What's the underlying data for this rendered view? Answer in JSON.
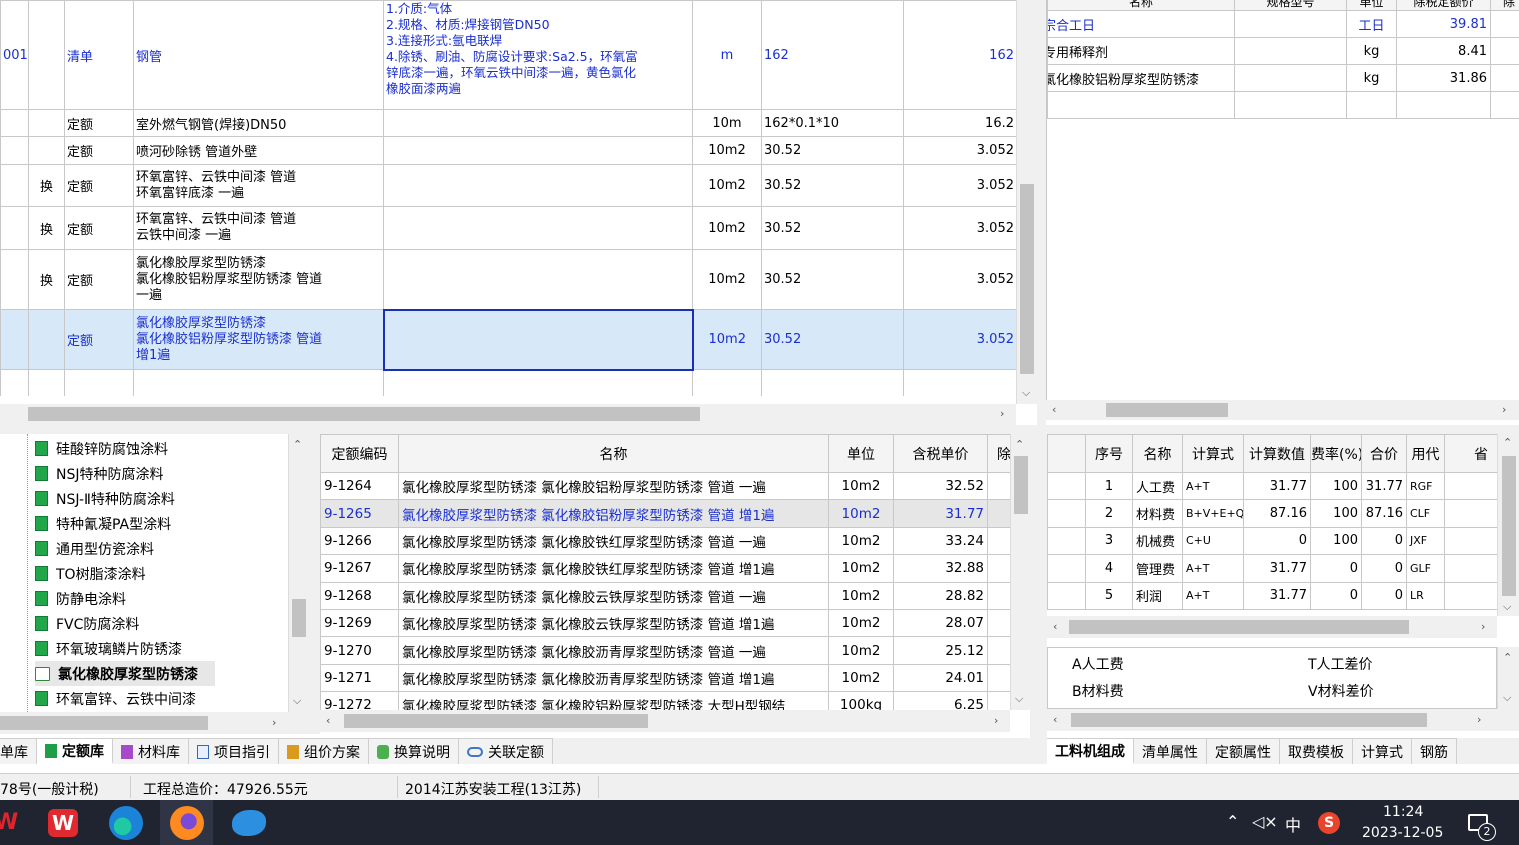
{
  "main_grid": {
    "rows": [
      {
        "code": "001",
        "mark": "",
        "type": "清单",
        "name": "钢管",
        "features": "1.介质:气体\n2.规格、材质:焊接钢管DN50\n3.连接形式:氩电联焊\n4.除锈、刷油、防腐设计要求:Sa2.5，环氧富\n锌底漆一遍，环氧云铁中间漆一遍，黄色氯化\n橡胶面漆两遍",
        "unit": "m",
        "expr": "162",
        "qty": "162"
      },
      {
        "code": "",
        "mark": "",
        "type": "定额",
        "name": "室外燃气钢管(焊接)DN50",
        "features": "",
        "unit": "10m",
        "expr": "162*0.1*10",
        "qty": "16.2"
      },
      {
        "code": "",
        "mark": "",
        "type": "定额",
        "name": "喷河砂除锈 管道外壁",
        "features": "",
        "unit": "10m2",
        "expr": "30.52",
        "qty": "3.052"
      },
      {
        "code": "",
        "mark": "换",
        "type": "定额",
        "name": "环氧富锌、云铁中间漆 管道\n环氧富锌底漆 一遍",
        "features": "",
        "unit": "10m2",
        "expr": "30.52",
        "qty": "3.052"
      },
      {
        "code": "",
        "mark": "换",
        "type": "定额",
        "name": "环氧富锌、云铁中间漆 管道\n云铁中间漆 一遍",
        "features": "",
        "unit": "10m2",
        "expr": "30.52",
        "qty": "3.052"
      },
      {
        "code": "",
        "mark": "换",
        "type": "定额",
        "name": "氯化橡胶厚浆型防锈漆\n氯化橡胶铝粉厚浆型防锈漆 管道\n一遍",
        "features": "",
        "unit": "10m2",
        "expr": "30.52",
        "qty": "3.052"
      },
      {
        "code": "",
        "mark": "",
        "type": "定额",
        "name": "氯化橡胶厚浆型防锈漆\n氯化橡胶铝粉厚浆型防锈漆 管道\n增1遍",
        "features": "",
        "unit": "10m2",
        "expr": "30.52",
        "qty": "3.052"
      }
    ]
  },
  "right_top": {
    "headers": [
      "名称",
      "规格型号",
      "单位",
      "除税定额价",
      "除"
    ],
    "rows": [
      {
        "name": "宗合工日",
        "spec": "",
        "unit": "工日",
        "price": "39.81"
      },
      {
        "name": "专用稀释剂",
        "spec": "",
        "unit": "kg",
        "price": "8.41"
      },
      {
        "name": "氯化橡胶铝粉厚浆型防锈漆",
        "spec": "",
        "unit": "kg",
        "price": "31.86"
      }
    ]
  },
  "tree": {
    "items": [
      "硅酸锌防腐蚀涂料",
      "NSJ特种防腐涂料",
      "NSJ-Ⅱ特种防腐涂料",
      "特种氰凝PA型涂料",
      "通用型仿瓷涂料",
      "TO树脂漆涂料",
      "防静电涂料",
      "FVC防腐涂料",
      "环氧玻璃鳞片防锈漆",
      "氯化橡胶厚浆型防锈漆",
      "环氧富锌、云铁中间漆"
    ],
    "active_index": 9
  },
  "quota": {
    "headers": [
      "定额编码",
      "名称",
      "单位",
      "含税单价",
      "除"
    ],
    "rows": [
      {
        "code": "9-1264",
        "name": "氯化橡胶厚浆型防锈漆 氯化橡胶铝粉厚浆型防锈漆 管道 一遍",
        "unit": "10m2",
        "price": "32.52"
      },
      {
        "code": "9-1265",
        "name": "氯化橡胶厚浆型防锈漆 氯化橡胶铝粉厚浆型防锈漆 管道 增1遍",
        "unit": "10m2",
        "price": "31.77"
      },
      {
        "code": "9-1266",
        "name": "氯化橡胶厚浆型防锈漆 氯化橡胶铁红厚浆型防锈漆 管道 一遍",
        "unit": "10m2",
        "price": "33.24"
      },
      {
        "code": "9-1267",
        "name": "氯化橡胶厚浆型防锈漆 氯化橡胶铁红厚浆型防锈漆 管道 增1遍",
        "unit": "10m2",
        "price": "32.88"
      },
      {
        "code": "9-1268",
        "name": "氯化橡胶厚浆型防锈漆 氯化橡胶云铁厚浆型防锈漆 管道 一遍",
        "unit": "10m2",
        "price": "28.82"
      },
      {
        "code": "9-1269",
        "name": "氯化橡胶厚浆型防锈漆 氯化橡胶云铁厚浆型防锈漆 管道 增1遍",
        "unit": "10m2",
        "price": "28.07"
      },
      {
        "code": "9-1270",
        "name": "氯化橡胶厚浆型防锈漆 氯化橡胶沥青厚浆型防锈漆 管道 一遍",
        "unit": "10m2",
        "price": "25.12"
      },
      {
        "code": "9-1271",
        "name": "氯化橡胶厚浆型防锈漆 氯化橡胶沥青厚浆型防锈漆 管道 增1遍",
        "unit": "10m2",
        "price": "24.01"
      },
      {
        "code": "9-1272",
        "name": "氯化橡胶厚浆型防锈漆 氯化橡胶铝粉厚浆型防锈漆 大型H型钢结",
        "unit": "100kg",
        "price": "6.25"
      }
    ]
  },
  "cost": {
    "headers": [
      "序号",
      "名称",
      "计算式",
      "计算数值",
      "费率(%)",
      "合价",
      "用代",
      "省"
    ],
    "rows": [
      {
        "no": "1",
        "name": "人工费",
        "formula": "A+T",
        "value": "31.77",
        "rate": "100",
        "total": "31.77",
        "code": "RGF"
      },
      {
        "no": "2",
        "name": "材料费",
        "formula": "B+V+E+Q-",
        "value": "87.16",
        "rate": "100",
        "total": "87.16",
        "code": "CLF"
      },
      {
        "no": "3",
        "name": "机械费",
        "formula": "C+U",
        "value": "0",
        "rate": "100",
        "total": "0",
        "code": "JXF"
      },
      {
        "no": "4",
        "name": "管理费",
        "formula": "A+T",
        "value": "31.77",
        "rate": "0",
        "total": "0",
        "code": "GLF"
      },
      {
        "no": "5",
        "name": "利润",
        "formula": "A+T",
        "value": "31.77",
        "rate": "0",
        "total": "0",
        "code": "LR"
      }
    ]
  },
  "legend": {
    "left": [
      "A人工费",
      "B材料费"
    ],
    "right": [
      "T人工差价",
      "V材料差价"
    ]
  },
  "bottom_tabs_left": [
    "单库",
    "定额库",
    "材料库",
    "项目指引",
    "组价方案",
    "换算说明",
    "关联定额"
  ],
  "bottom_tabs_left_active": 1,
  "bottom_tabs_right": [
    "工料机组成",
    "清单属性",
    "定额属性",
    "取费模板",
    "计算式",
    "钢筋"
  ],
  "bottom_tabs_right_active": 0,
  "status": {
    "file": "78号(一般计税)",
    "total": "工程总造价：47926.55元",
    "standard": "2014江苏安装工程(13江苏)"
  },
  "taskbar": {
    "time": "11:24",
    "date": "2023-12-05",
    "ime": "中",
    "notify_count": "2"
  }
}
